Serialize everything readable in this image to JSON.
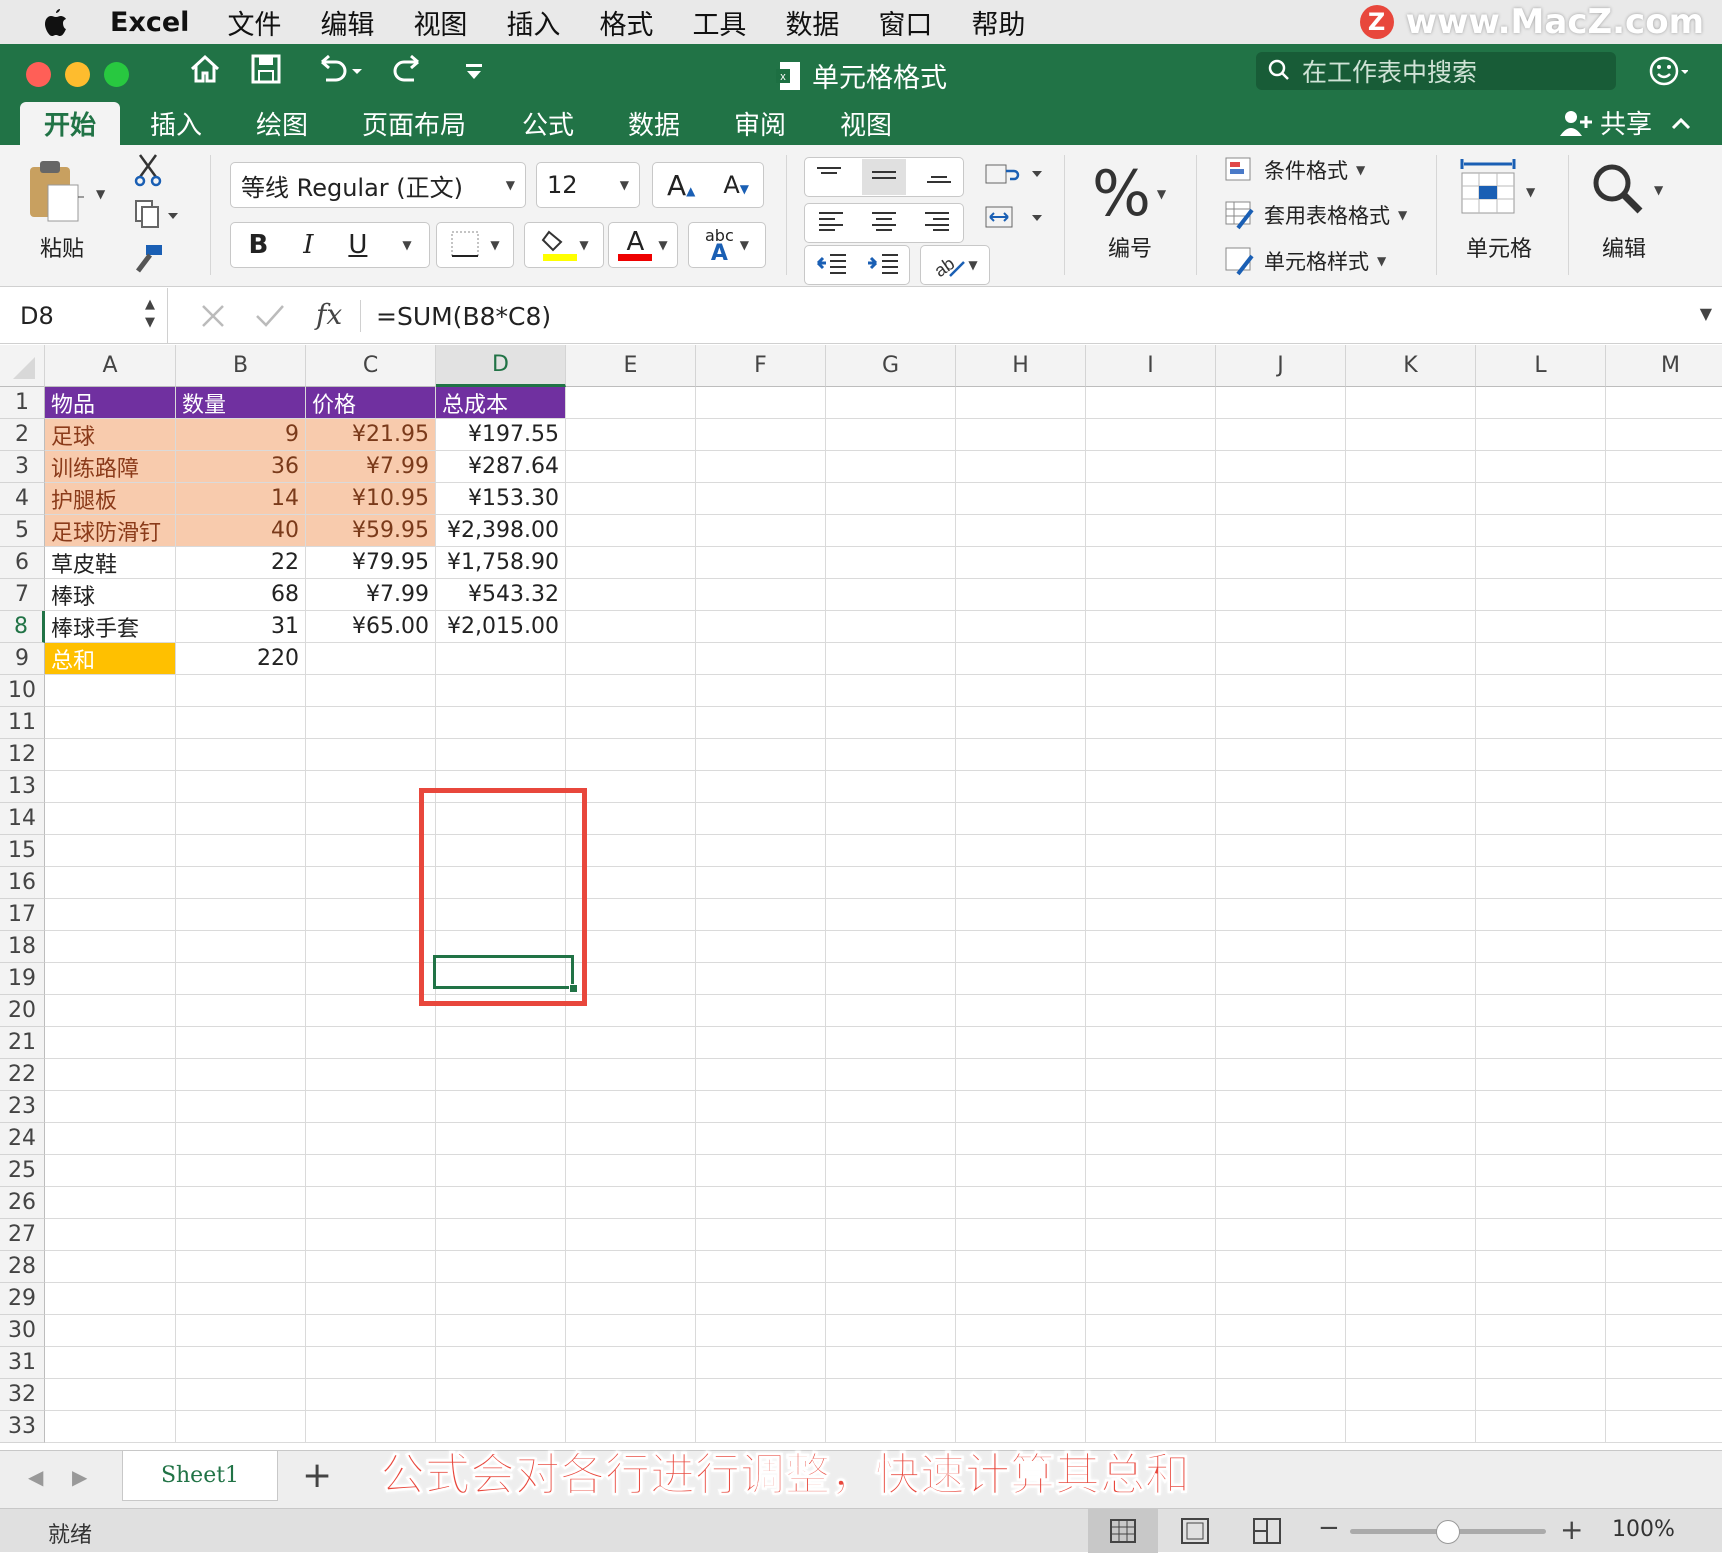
{
  "menubar": {
    "app": "Excel",
    "items": [
      "文件",
      "编辑",
      "视图",
      "插入",
      "格式",
      "工具",
      "数据",
      "窗口",
      "帮助"
    ],
    "watermark": "www.MacZ.com",
    "watermark_badge": "Z"
  },
  "title": {
    "doc": "单元格格式",
    "search_placeholder": "在工作表中搜索"
  },
  "tabs": [
    "开始",
    "插入",
    "绘图",
    "页面布局",
    "公式",
    "数据",
    "审阅",
    "视图"
  ],
  "share": "共享",
  "ribbon": {
    "paste": "粘贴",
    "font_name": "等线 Regular (正文)",
    "font_size": "12",
    "bold": "B",
    "italic": "I",
    "underline": "U",
    "number_symbol": "%",
    "number": "编号",
    "conditional": "条件格式",
    "table_format": "套用表格格式",
    "cell_style": "单元格样式",
    "cells": "单元格",
    "edit": "编辑",
    "abc": "abc",
    "inc_font": "A",
    "dec_font": "A",
    "font_color": "A"
  },
  "formula_bar": {
    "name_box": "D8",
    "fx": "fx",
    "formula": "=SUM(B8*C8)"
  },
  "columns": [
    "A",
    "B",
    "C",
    "D",
    "E",
    "F",
    "G",
    "H",
    "I",
    "J",
    "K",
    "L",
    "M"
  ],
  "rows": [
    "1",
    "2",
    "3",
    "4",
    "5",
    "6",
    "7",
    "8",
    "9",
    "10",
    "11",
    "12",
    "13",
    "14",
    "15",
    "16",
    "17",
    "18",
    "19",
    "20",
    "21",
    "22",
    "23",
    "24",
    "25",
    "26",
    "27",
    "28",
    "29",
    "30",
    "31",
    "32",
    "33"
  ],
  "table": {
    "headers": [
      "物品",
      "数量",
      "价格",
      "总成本"
    ],
    "rows": [
      {
        "item": "足球",
        "qty": "9",
        "price": "¥21.95",
        "total": "¥197.55"
      },
      {
        "item": "训练路障",
        "qty": "36",
        "price": "¥7.99",
        "total": "¥287.64"
      },
      {
        "item": "护腿板",
        "qty": "14",
        "price": "¥10.95",
        "total": "¥153.30"
      },
      {
        "item": "足球防滑钉",
        "qty": "40",
        "price": "¥59.95",
        "total": "¥2,398.00"
      },
      {
        "item": "草皮鞋",
        "qty": "22",
        "price": "¥79.95",
        "total": "¥1,758.90"
      },
      {
        "item": "棒球",
        "qty": "68",
        "price": "¥7.99",
        "total": "¥543.32"
      },
      {
        "item": "棒球手套",
        "qty": "31",
        "price": "¥65.00",
        "total": "¥2,015.00"
      }
    ],
    "total_label": "总和",
    "total_qty": "220"
  },
  "sheet_tab": "Sheet1",
  "caption": "公式会对各行进行调整，快速计算其总和",
  "status": {
    "ready": "就绪",
    "zoom": "100%",
    "zoom_minus": "−",
    "zoom_plus": "+"
  },
  "colors": {
    "excel_green": "#217346",
    "header_purple": "#7030a0",
    "peach": "#f8cbad",
    "orange": "#ffc000",
    "highlight_red": "#e8473c"
  }
}
